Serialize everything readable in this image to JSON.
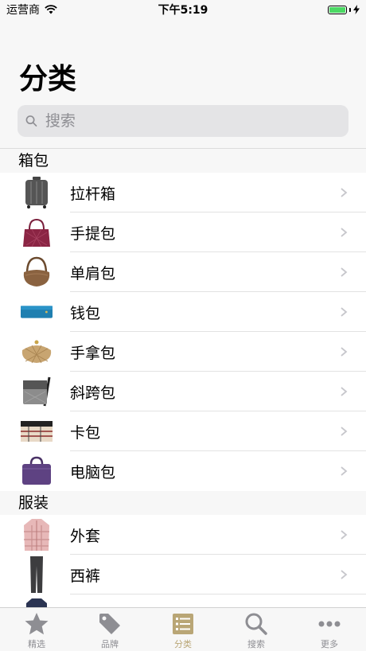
{
  "status": {
    "carrier": "运营商",
    "time": "下午5:19",
    "battery_level": 1.0
  },
  "page": {
    "title": "分类"
  },
  "search": {
    "placeholder": "搜索"
  },
  "sections": [
    {
      "header": "箱包",
      "items": [
        {
          "label": "拉杆箱",
          "thumb": "suitcase-thumb"
        },
        {
          "label": "手提包",
          "thumb": "handbag-thumb"
        },
        {
          "label": "单肩包",
          "thumb": "shoulder-bag-thumb"
        },
        {
          "label": "钱包",
          "thumb": "wallet-thumb"
        },
        {
          "label": "手拿包",
          "thumb": "clutch-thumb"
        },
        {
          "label": "斜跨包",
          "thumb": "crossbody-bag-thumb"
        },
        {
          "label": "卡包",
          "thumb": "card-holder-thumb"
        },
        {
          "label": "电脑包",
          "thumb": "laptop-bag-thumb"
        }
      ]
    },
    {
      "header": "服装",
      "items": [
        {
          "label": "外套",
          "thumb": "coat-thumb"
        },
        {
          "label": "西裤",
          "thumb": "trousers-thumb"
        }
      ]
    }
  ],
  "tabbar": {
    "items": [
      {
        "label": "精选",
        "icon": "star-icon"
      },
      {
        "label": "品牌",
        "icon": "tag-icon"
      },
      {
        "label": "分类",
        "icon": "list-icon"
      },
      {
        "label": "搜索",
        "icon": "search-icon"
      },
      {
        "label": "更多",
        "icon": "more-icon"
      }
    ],
    "active_index": 2
  },
  "colors": {
    "accent": "#b9a676",
    "inactive": "#8e8e93",
    "battery": "#4cd964"
  }
}
